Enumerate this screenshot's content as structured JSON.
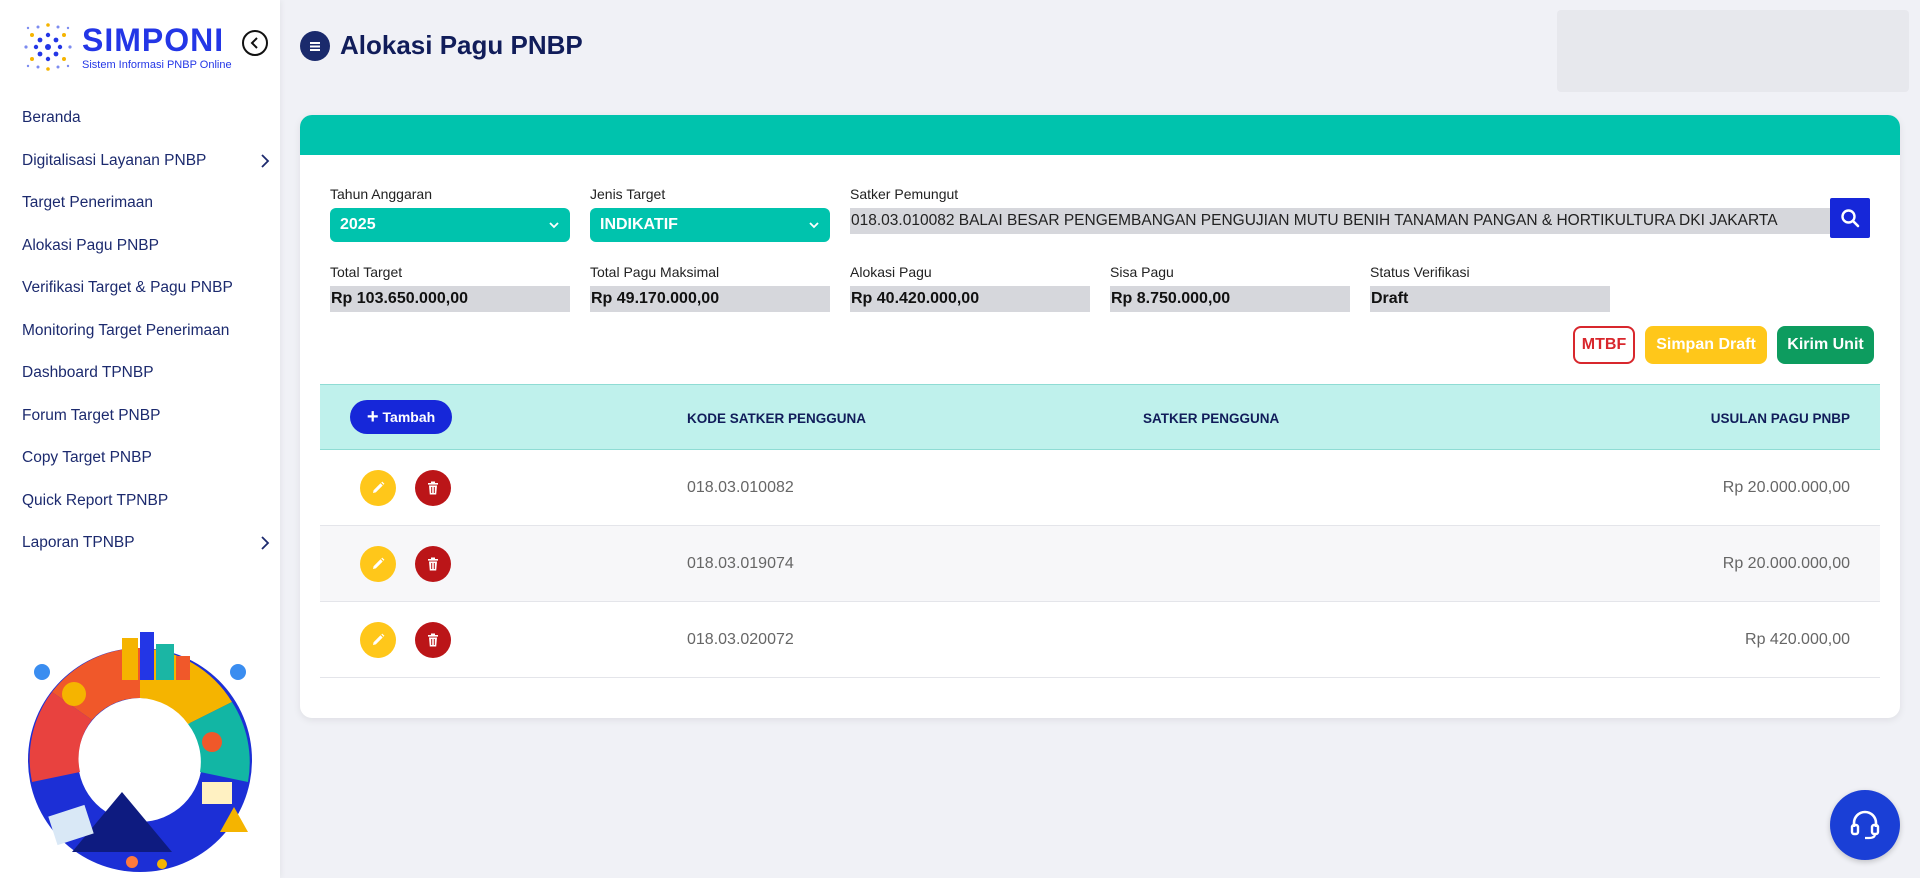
{
  "brand": {
    "name": "SIMPONI",
    "subtitle": "Sistem Informasi PNBP Online"
  },
  "sidebar": {
    "items": [
      {
        "label": "Beranda",
        "has_submenu": false
      },
      {
        "label": "Digitalisasi Layanan PNBP",
        "has_submenu": true
      },
      {
        "label": "Target Penerimaan",
        "has_submenu": false
      },
      {
        "label": "Alokasi Pagu PNBP",
        "has_submenu": false
      },
      {
        "label": "Verifikasi Target & Pagu PNBP",
        "has_submenu": false
      },
      {
        "label": "Monitoring Target Penerimaan",
        "has_submenu": false
      },
      {
        "label": "Dashboard TPNBP",
        "has_submenu": false
      },
      {
        "label": "Forum Target PNBP",
        "has_submenu": false
      },
      {
        "label": "Copy Target PNBP",
        "has_submenu": false
      },
      {
        "label": "Quick Report TPNBP",
        "has_submenu": false
      },
      {
        "label": "Laporan TPNBP",
        "has_submenu": true
      }
    ]
  },
  "header": {
    "title": "Alokasi Pagu PNBP"
  },
  "form": {
    "tahun_anggaran": {
      "label": "Tahun Anggaran",
      "value": "2025"
    },
    "jenis_target": {
      "label": "Jenis Target",
      "value": "INDIKATIF"
    },
    "satker_pemungut": {
      "label": "Satker Pemungut",
      "value": "018.03.010082 BALAI BESAR PENGEMBANGAN PENGUJIAN MUTU BENIH TANAMAN PANGAN & HORTIKULTURA DKI JAKARTA"
    },
    "total_target": {
      "label": "Total Target",
      "value": "Rp 103.650.000,00"
    },
    "total_pagu_maksimal": {
      "label": "Total Pagu Maksimal",
      "value": "Rp 49.170.000,00"
    },
    "alokasi_pagu": {
      "label": "Alokasi Pagu",
      "value": "Rp 40.420.000,00"
    },
    "sisa_pagu": {
      "label": "Sisa Pagu",
      "value": "Rp 8.750.000,00"
    },
    "status_verifikasi": {
      "label": "Status Verifikasi",
      "value": "Draft"
    }
  },
  "actions": {
    "mtbf": "MTBF",
    "simpan_draft": "Simpan Draft",
    "kirim_unit": "Kirim Unit"
  },
  "table": {
    "add_label": "Tambah",
    "columns": [
      "KODE SATKER PENGGUNA",
      "SATKER PENGGUNA",
      "USULAN PAGU PNBP"
    ],
    "rows": [
      {
        "kode": "018.03.010082",
        "satker": "",
        "usulan": "Rp 20.000.000,00"
      },
      {
        "kode": "018.03.019074",
        "satker": "",
        "usulan": "Rp 20.000.000,00"
      },
      {
        "kode": "018.03.020072",
        "satker": "",
        "usulan": "Rp 420.000,00"
      }
    ]
  },
  "colors": {
    "teal": "#00c3ad",
    "primary": "#1627d9",
    "warning": "#ffc71a",
    "danger": "#bb1518",
    "success": "#0d9c5f"
  },
  "icons": [
    "logo-dots-icon",
    "chevron-left-icon",
    "chevron-right-icon",
    "list-icon",
    "chevron-down-icon",
    "search-icon",
    "plus-icon",
    "pencil-icon",
    "trash-icon",
    "headset-icon"
  ]
}
